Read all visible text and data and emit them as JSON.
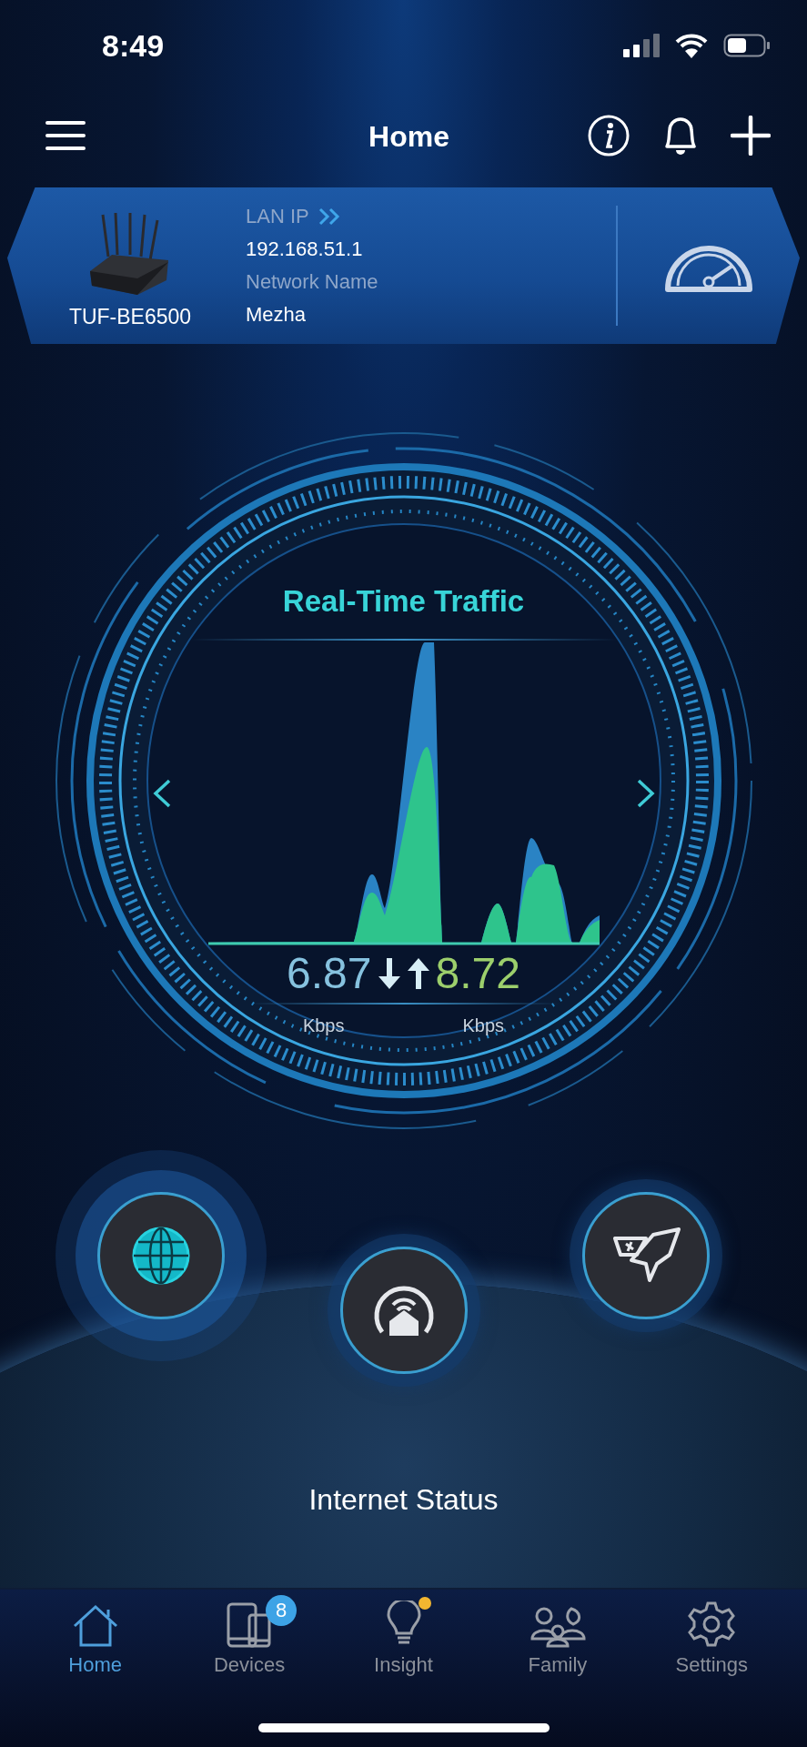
{
  "status_bar": {
    "time": "8:49"
  },
  "header": {
    "title": "Home"
  },
  "router_card": {
    "model": "TUF-BE6500",
    "lan_ip_label": "LAN IP",
    "lan_ip": "192.168.51.1",
    "network_name_label": "Network Name",
    "network_name": "Mezha"
  },
  "traffic": {
    "title": "Real-Time Traffic",
    "download": {
      "value": "6.87",
      "unit": "Kbps"
    },
    "upload": {
      "value": "8.72",
      "unit": "Kbps"
    }
  },
  "action_buttons": [
    {
      "kind": "globe",
      "selected": true
    },
    {
      "kind": "home",
      "selected": false
    },
    {
      "kind": "rocket",
      "selected": false
    }
  ],
  "status_label": "Internet Status",
  "tab_bar": [
    {
      "kind": "home",
      "label": "Home",
      "selected": true,
      "notification": false
    },
    {
      "kind": "devices",
      "label": "Devices",
      "selected": false,
      "badge": "8",
      "notification": false
    },
    {
      "kind": "insight",
      "label": "Insight",
      "selected": false,
      "notification": true
    },
    {
      "kind": "family",
      "label": "Family",
      "selected": false,
      "notification": false
    },
    {
      "kind": "settings",
      "label": "Settings",
      "selected": false,
      "notification": false
    }
  ]
}
